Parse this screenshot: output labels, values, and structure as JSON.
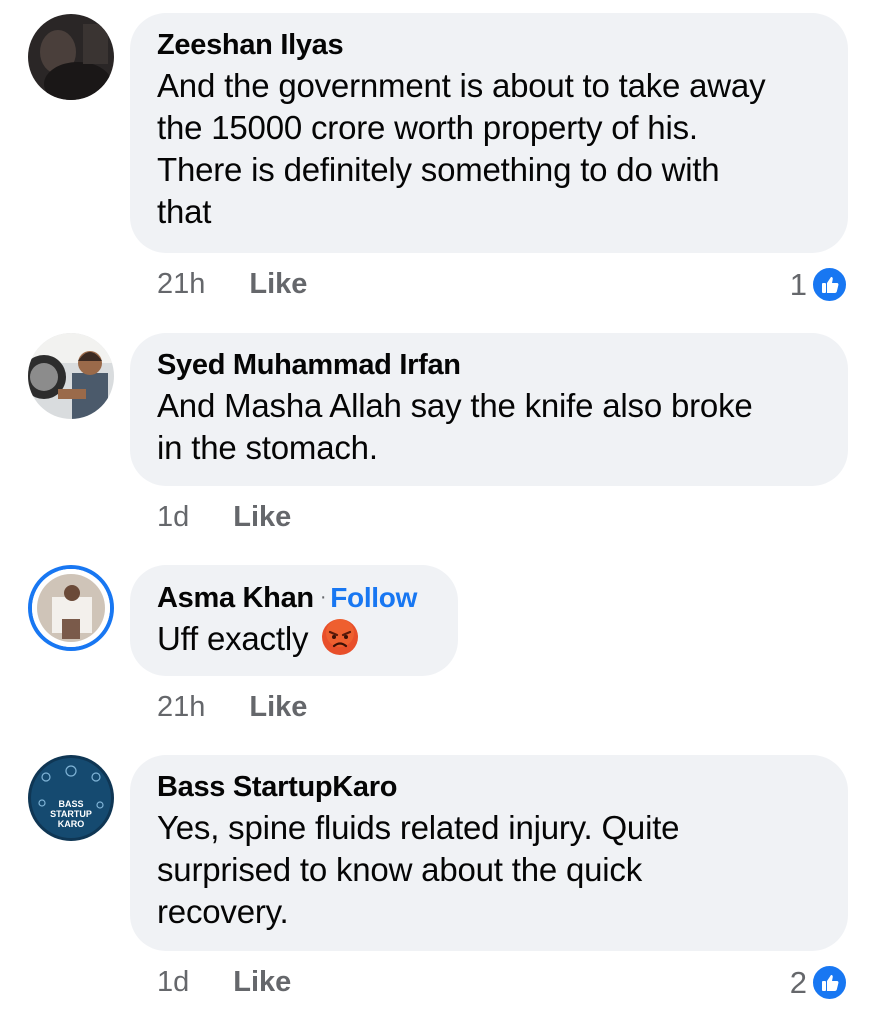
{
  "comments": [
    {
      "author": "Zeeshan Ilyas",
      "text_lines": [
        "And the government is about to take away",
        "the 15000 crore worth property of his.",
        "There is definitely something to do with",
        "that"
      ],
      "time": "21h",
      "like_label": "Like",
      "reaction_count": "1",
      "reaction_icon": "thumbs-up-icon"
    },
    {
      "author": "Syed Muhammad Irfan",
      "text_lines": [
        "And Masha Allah say the knife also broke",
        "in the stomach."
      ],
      "time": "1d",
      "like_label": "Like"
    },
    {
      "author": "Asma Khan",
      "separator": "·",
      "follow_label": "Follow",
      "text": "Uff exactly",
      "emoji": "angry-face-icon",
      "time": "21h",
      "like_label": "Like"
    },
    {
      "author": "Bass StartupKaro",
      "text_lines": [
        "Yes, spine fluids related injury. Quite",
        "surprised to know about the quick",
        "recovery."
      ],
      "time": "1d",
      "like_label": "Like",
      "reaction_count": "2",
      "reaction_icon": "thumbs-up-icon",
      "avatar_text": [
        "BASS",
        "STARTUP",
        "KARO"
      ]
    }
  ],
  "colors": {
    "bubble_bg": "#f0f2f5",
    "secondary_text": "#65676b",
    "accent_blue": "#1877f2",
    "primary_text": "#050505"
  }
}
